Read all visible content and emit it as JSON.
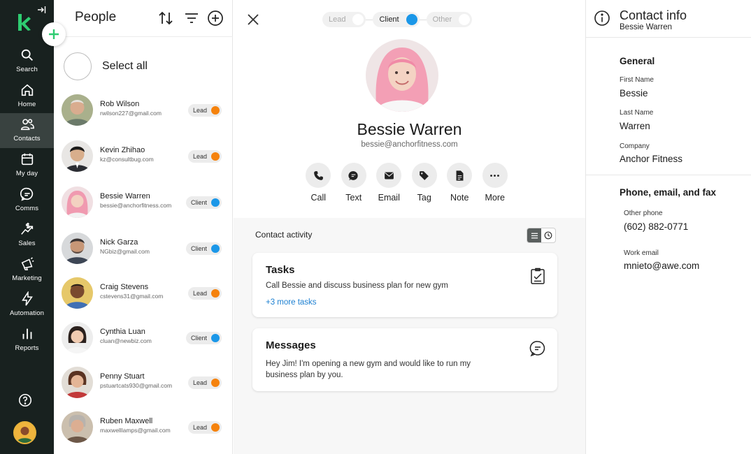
{
  "colors": {
    "nav_bg": "#18211f",
    "brand_green": "#2ecc71",
    "lead": "#f5820d",
    "client": "#1b97e8",
    "link": "#1b7fd1"
  },
  "nav": {
    "items": [
      {
        "label": "Search",
        "icon": "search-icon"
      },
      {
        "label": "Home",
        "icon": "home-icon"
      },
      {
        "label": "Contacts",
        "icon": "contacts-icon",
        "active": true
      },
      {
        "label": "My day",
        "icon": "calendar-icon"
      },
      {
        "label": "Comms",
        "icon": "chat-icon"
      },
      {
        "label": "Sales",
        "icon": "sales-icon"
      },
      {
        "label": "Marketing",
        "icon": "megaphone-icon"
      },
      {
        "label": "Automation",
        "icon": "bolt-icon"
      },
      {
        "label": "Reports",
        "icon": "bar-chart-icon"
      }
    ]
  },
  "people": {
    "title": "People",
    "select_all": "Select all",
    "list": [
      {
        "name": "Rob Wilson",
        "email": "rwilson227@gmail.com",
        "status": "Lead"
      },
      {
        "name": "Kevin Zhihao",
        "email": "kz@consultbug.com",
        "status": "Lead"
      },
      {
        "name": "Bessie Warren",
        "email": "bessie@anchorfitness.com",
        "status": "Client"
      },
      {
        "name": "Nick Garza",
        "email": "NGbiz@gmail.com",
        "status": "Client"
      },
      {
        "name": "Craig Stevens",
        "email": "cstevens31@gmail.com",
        "status": "Lead"
      },
      {
        "name": "Cynthia Luan",
        "email": "cluan@newbiz.com",
        "status": "Client"
      },
      {
        "name": "Penny Stuart",
        "email": "pstuartcats930@gmail.com",
        "status": "Lead"
      },
      {
        "name": "Ruben Maxwell",
        "email": "maxwelllamps@gmail.com",
        "status": "Lead"
      }
    ]
  },
  "detail": {
    "statuses": [
      {
        "label": "Lead",
        "active": false
      },
      {
        "label": "Client",
        "active": true
      },
      {
        "label": "Other",
        "active": false
      }
    ],
    "name": "Bessie Warren",
    "email": "bessie@anchorfitness.com",
    "actions": [
      {
        "label": "Call",
        "icon": "phone-icon"
      },
      {
        "label": "Text",
        "icon": "message-icon"
      },
      {
        "label": "Email",
        "icon": "envelope-icon"
      },
      {
        "label": "Tag",
        "icon": "tag-icon"
      },
      {
        "label": "Note",
        "icon": "note-icon"
      },
      {
        "label": "More",
        "icon": "more-icon"
      }
    ],
    "activity": {
      "title": "Contact activity",
      "tasks": {
        "title": "Tasks",
        "body": "Call Bessie and discuss business plan for new gym",
        "link": "+3 more tasks"
      },
      "messages": {
        "title": "Messages",
        "body_line1": "Hey Jim! I'm opening a new gym and would like to run my",
        "body_line2": "business plan by you."
      }
    }
  },
  "info": {
    "title": "Contact info",
    "subtitle": "Bessie Warren",
    "general": {
      "title": "General",
      "first_name_label": "First Name",
      "first_name": "Bessie",
      "last_name_label": "Last Name",
      "last_name": "Warren",
      "company_label": "Company",
      "company": "Anchor Fitness"
    },
    "contact": {
      "title": "Phone, email, and fax",
      "phone_label": "Other phone",
      "phone": "(602) 882-0771",
      "email_label": "Work email",
      "email": "mnieto@awe.com"
    }
  }
}
